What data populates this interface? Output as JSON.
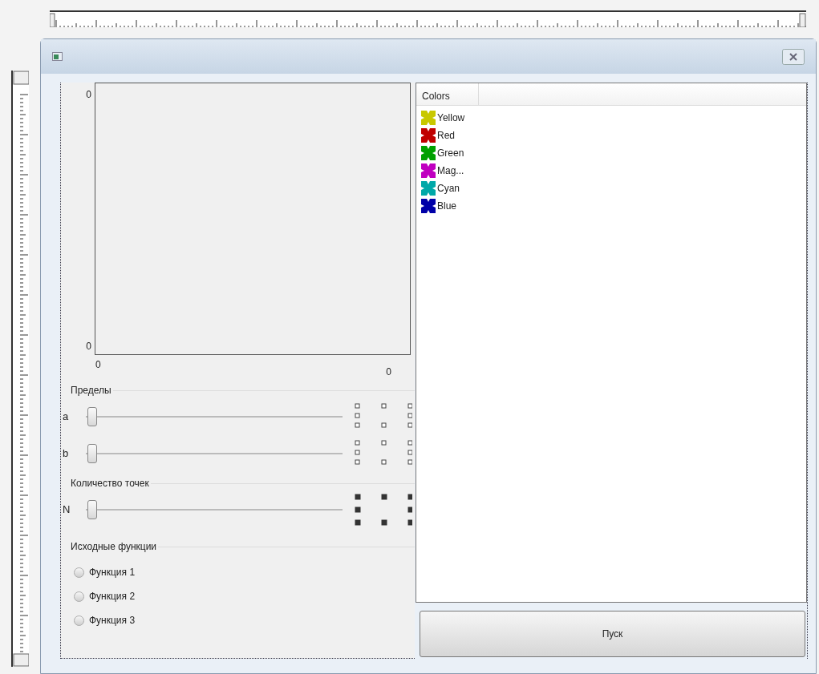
{
  "plot": {
    "y_labels": [
      "0",
      "0"
    ],
    "x_labels": [
      "0",
      "0"
    ]
  },
  "groups": [
    {
      "title": "Пределы",
      "sliders": [
        {
          "label": "a",
          "level": 0
        },
        {
          "label": "b",
          "level": 0
        }
      ],
      "kind": "outline"
    },
    {
      "title": "Количество точек",
      "sliders": [
        {
          "label": "N",
          "level": 0
        }
      ],
      "kind": "solid"
    }
  ],
  "functions": {
    "title": "Исходные функции",
    "options": [
      {
        "label": "Функция 1",
        "selected": false
      },
      {
        "label": "Функция 2",
        "selected": false
      },
      {
        "label": "Функция 3",
        "selected": false
      }
    ]
  },
  "colors_list": {
    "header": "Colors",
    "items": [
      {
        "label": "Yellow",
        "color": "#c8c800"
      },
      {
        "label": "Red",
        "color": "#c00000"
      },
      {
        "label": "Green",
        "color": "#00a000"
      },
      {
        "label": "Mag...",
        "color": "#c000c0"
      },
      {
        "label": "Cyan",
        "color": "#00a8a8"
      },
      {
        "label": "Blue",
        "color": "#0000a8"
      }
    ]
  },
  "run_button": "Пуск"
}
